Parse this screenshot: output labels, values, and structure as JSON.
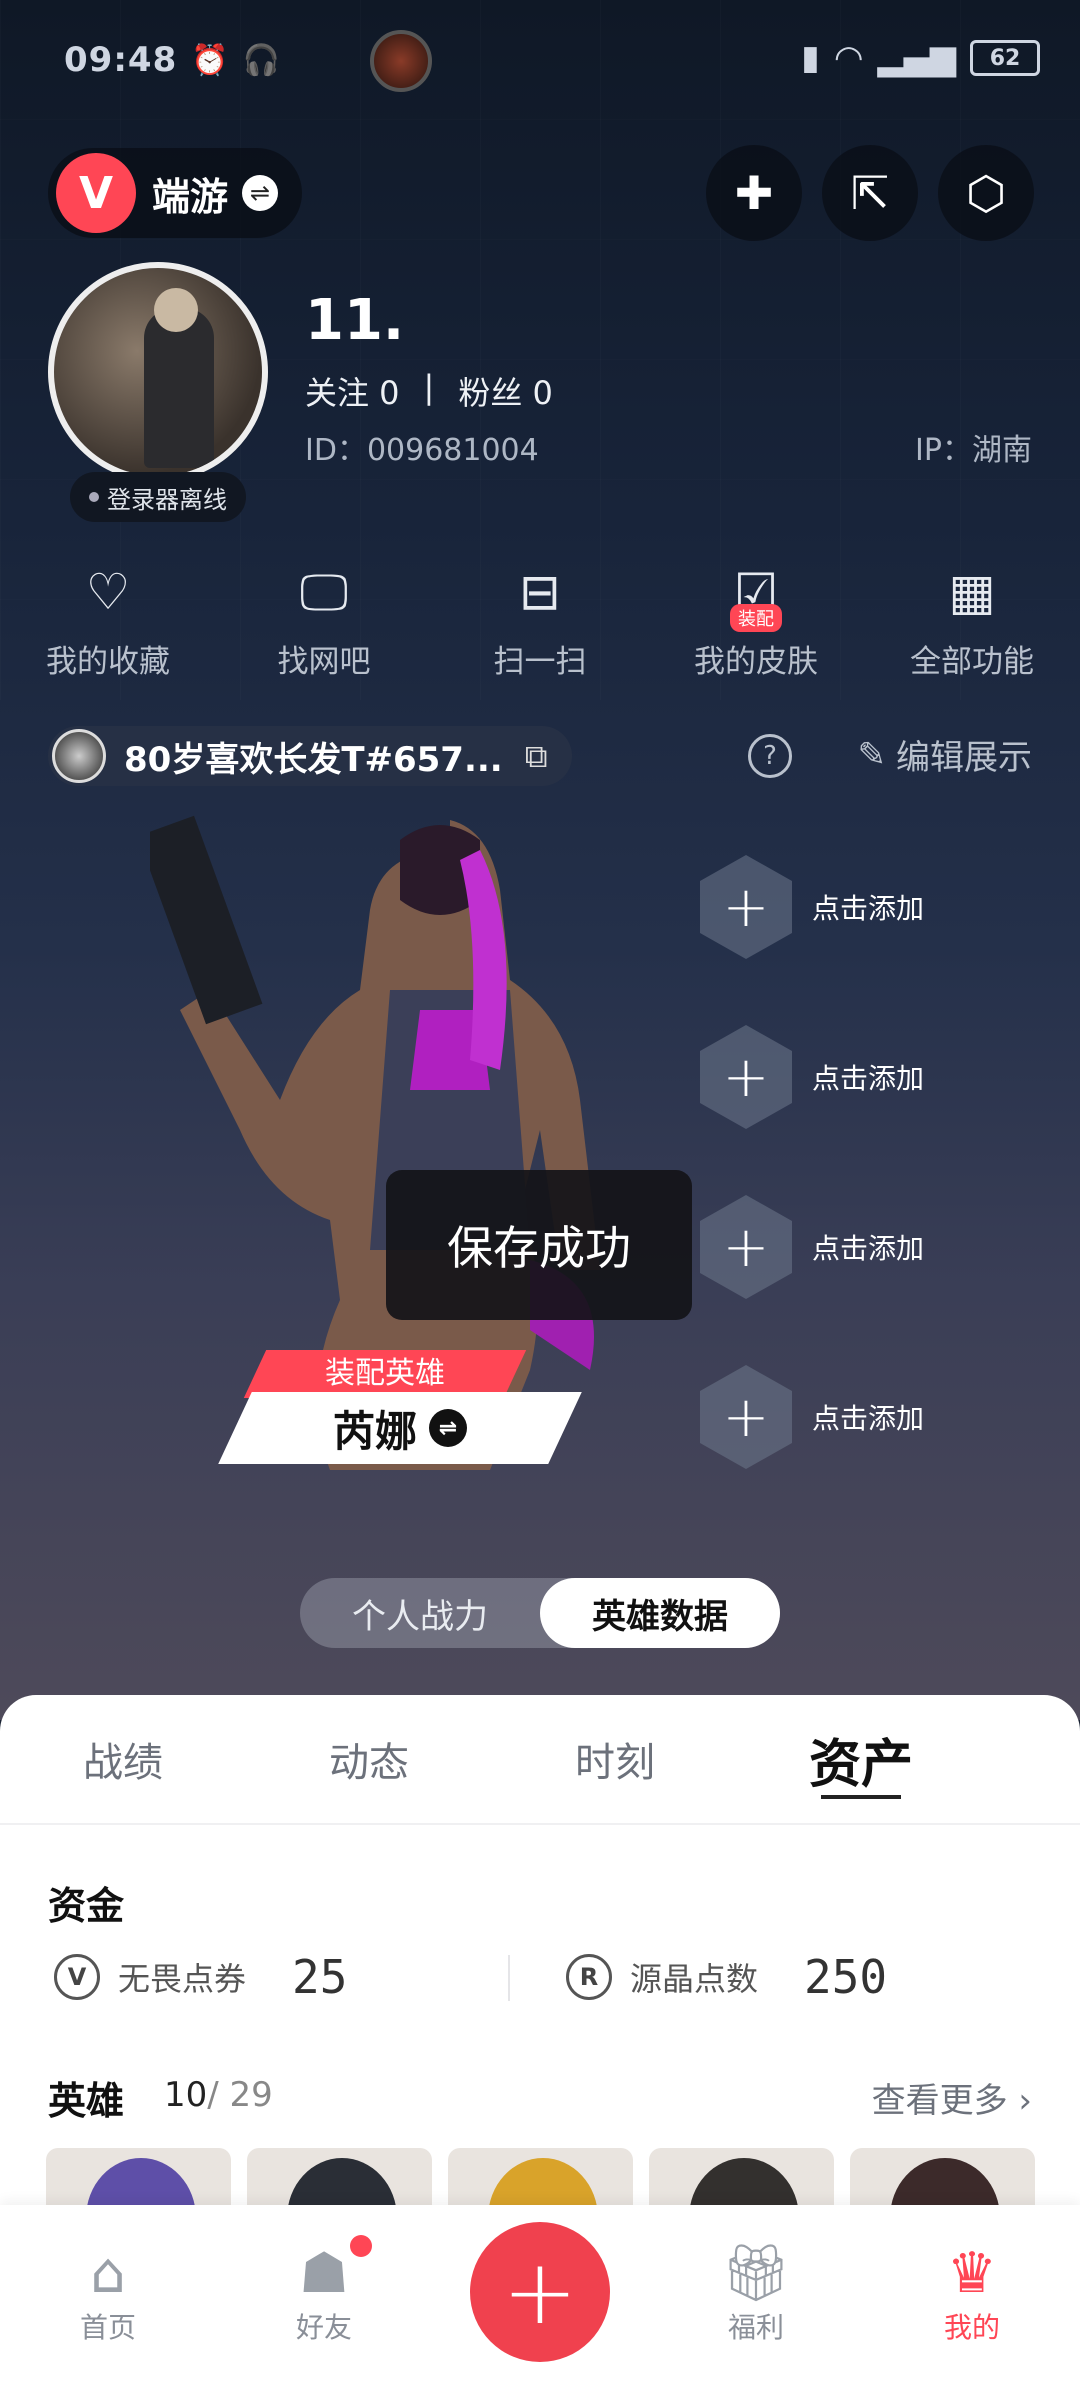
{
  "status_bar": {
    "time": "09:48",
    "battery": "62"
  },
  "header": {
    "brand_name": "端游"
  },
  "profile": {
    "username": "11.",
    "following_label": "关注 0",
    "followers_label": "粉丝 0",
    "separator": "|",
    "id_text": "ID：009681004",
    "ip_text": "IP：湖南",
    "offline_text": "登录器离线"
  },
  "quick_actions": [
    {
      "label": "我的收藏",
      "icon": "heart-icon"
    },
    {
      "label": "找网吧",
      "icon": "monitor-icon"
    },
    {
      "label": "扫一扫",
      "icon": "scan-icon"
    },
    {
      "label": "我的皮肤",
      "icon": "skin-icon",
      "badge": "装配"
    },
    {
      "label": "全部功能",
      "icon": "grid-icon"
    }
  ],
  "game_account": {
    "name": "80岁喜欢长发T#657..."
  },
  "edit_show_label": "编辑展示",
  "add_slots": [
    "点击添加",
    "点击添加",
    "点击添加",
    "点击添加"
  ],
  "toast": "保存成功",
  "equipped_hero": {
    "tag": "装配英雄",
    "name": "芮娜"
  },
  "segment": {
    "options": [
      "个人战力",
      "英雄数据"
    ],
    "active_index": 1
  },
  "tabs": [
    {
      "label": "战绩"
    },
    {
      "label": "动态"
    },
    {
      "label": "时刻"
    },
    {
      "label": "资产",
      "active": true
    }
  ],
  "funds": {
    "title": "资金",
    "items": [
      {
        "icon": "valorant-points-icon",
        "glyph": "V",
        "label": "无畏点券",
        "value": "25"
      },
      {
        "icon": "radianite-icon",
        "glyph": "R",
        "label": "源晶点数",
        "value": "250"
      }
    ]
  },
  "heroes": {
    "title": "英雄",
    "owned": "10",
    "total": "/ 29",
    "more_label": "查看更多 ›"
  },
  "bottom_nav": [
    {
      "label": "首页",
      "icon": "home-icon"
    },
    {
      "label": "好友",
      "icon": "friends-icon",
      "dot": true
    },
    {
      "label": "",
      "icon": "plus-icon"
    },
    {
      "label": "福利",
      "icon": "gift-icon"
    },
    {
      "label": "我的",
      "icon": "profile-icon",
      "active": true
    }
  ],
  "colors": {
    "accent": "#ff4655",
    "sheet": "#ffffff",
    "bg_dark": "#18243a"
  }
}
